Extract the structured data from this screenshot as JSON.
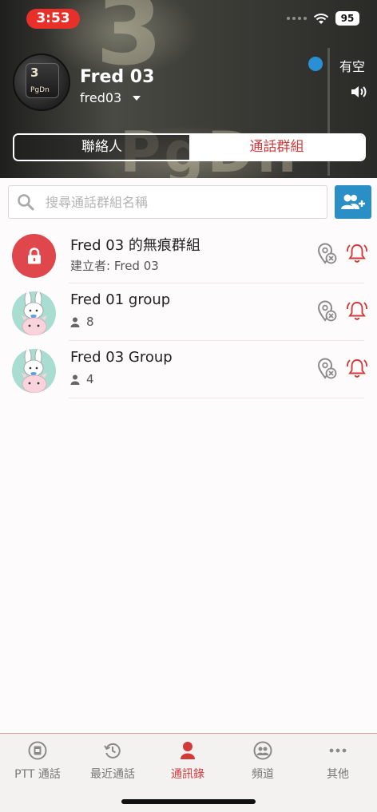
{
  "status_bar": {
    "time": "3:53",
    "battery": "95"
  },
  "profile": {
    "display_name": "Fred 03",
    "user_id": "fred03",
    "avatar_key_label": "3",
    "avatar_key_sublabel": "PgDn",
    "presence_label": "有空",
    "presence_color": "#2b8fd6"
  },
  "segment": {
    "tabs": [
      {
        "label": "聯絡人"
      },
      {
        "label": "通話群組"
      }
    ],
    "selected": 1
  },
  "search": {
    "placeholder": "搜尋通話群組名稱"
  },
  "groups": [
    {
      "title": "Fred 03 的無痕群組",
      "subtitle": "建立者: Fred 03",
      "avatar": "lock-icon"
    },
    {
      "title": "Fred 01 group",
      "member_count": "8",
      "avatar": "bunny-avatar"
    },
    {
      "title": "Fred 03 Group",
      "member_count": "4",
      "avatar": "bunny-avatar"
    }
  ],
  "tabbar": {
    "items": [
      {
        "label": "PTT 通話",
        "icon": "ptt-icon"
      },
      {
        "label": "最近通話",
        "icon": "history-icon"
      },
      {
        "label": "通訊錄",
        "icon": "contacts-icon"
      },
      {
        "label": "頻道",
        "icon": "channel-icon"
      },
      {
        "label": "其他",
        "icon": "more-icon"
      }
    ],
    "active_index": 2
  },
  "colors": {
    "accent_red": "#d23a3a",
    "action_blue": "#2b8fc7"
  }
}
